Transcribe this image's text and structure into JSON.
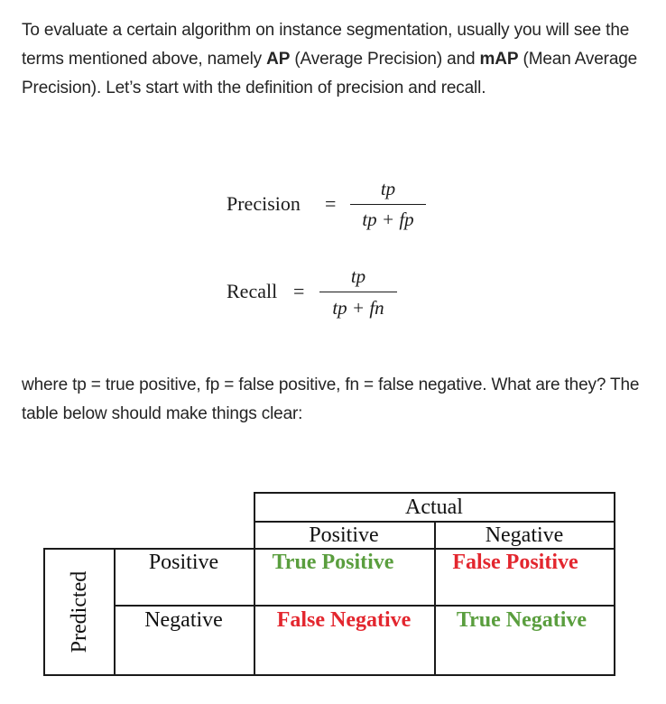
{
  "intro": {
    "part1": "To evaluate a certain algorithm on instance segmentation, usually you will see the terms mentioned above, namely ",
    "ap": "AP",
    "part2": " (Average Precision) and ",
    "map": "mAP",
    "part3": " (Mean Average Precision). Let’s start with the definition of precision and recall."
  },
  "precision_eq": {
    "label": "Precision",
    "equals": "=",
    "numerator": "tp",
    "denominator": "tp + fp"
  },
  "recall_eq": {
    "label": "Recall",
    "equals": "=",
    "numerator": "tp",
    "denominator": "tp + fn"
  },
  "where_text": "where tp = true positive, fp = false positive, fn = false negative. What are they? The table below should make things clear:",
  "table": {
    "actual_header": "Actual",
    "predicted_header": "Predicted",
    "col_positive": "Positive",
    "col_negative": "Negative",
    "row_positive": "Positive",
    "row_negative": "Negative",
    "tp": "True Positive",
    "fp": "False Positive",
    "fn": "False Negative",
    "tn": "True Negative",
    "colors": {
      "true": "#5a9e3e",
      "false": "#e3262e"
    }
  }
}
